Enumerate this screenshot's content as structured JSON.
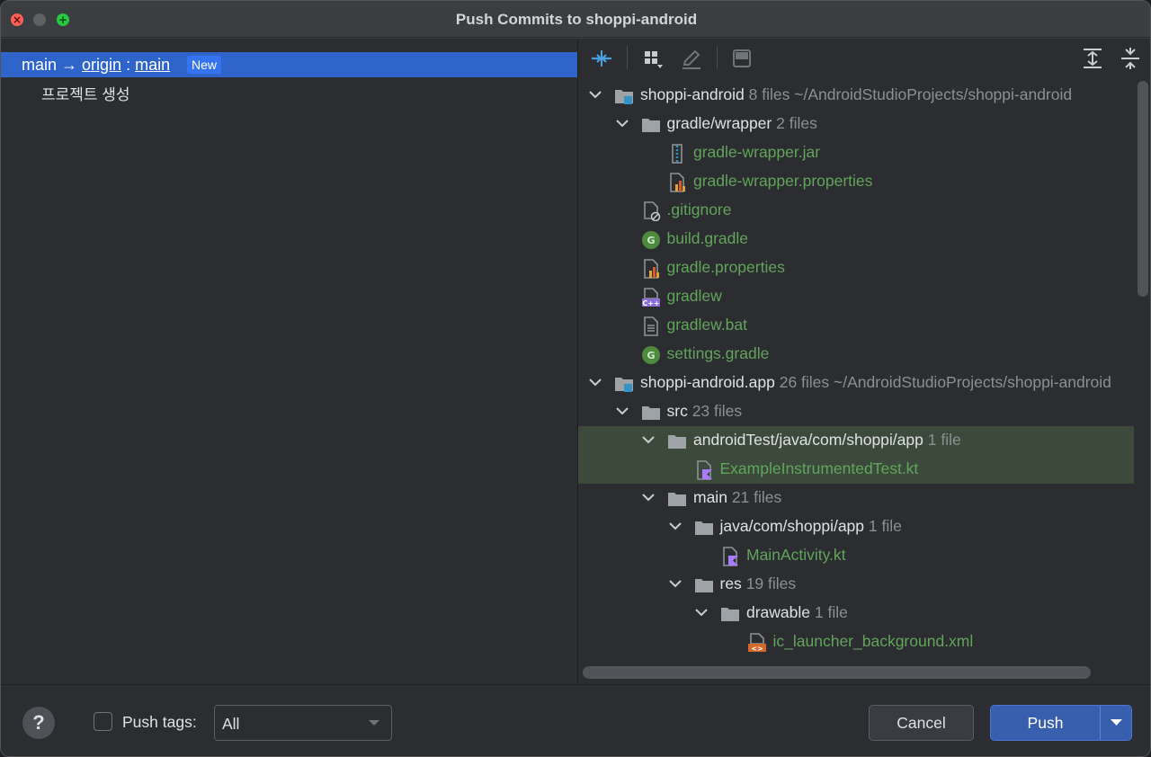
{
  "window": {
    "title": "Push Commits to shoppi-android"
  },
  "left": {
    "branch": {
      "local": "main",
      "arrow": "→",
      "remote": "origin",
      "colon": ":",
      "target": "main",
      "badge": "New"
    },
    "commits": [
      "프로젝트 생성"
    ]
  },
  "toolbar": {
    "icons": [
      "show-diff-icon",
      "group-by-icon",
      "edit-source-icon",
      "preview-icon",
      "expand-all-icon",
      "collapse-all-icon"
    ]
  },
  "tree": [
    {
      "label": "shoppi-android",
      "meta": "8 files ~/AndroidStudioProjects/shoppi-android",
      "icon": "module-icon",
      "color": "white",
      "expanded": true
    },
    {
      "label": "gradle/wrapper",
      "meta": "2 files",
      "icon": "folder-icon",
      "color": "white",
      "expanded": true
    },
    {
      "label": "gradle-wrapper.jar",
      "meta": "",
      "icon": "archive-file-icon",
      "color": "green"
    },
    {
      "label": "gradle-wrapper.properties",
      "meta": "",
      "icon": "properties-file-icon",
      "color": "green"
    },
    {
      "label": ".gitignore",
      "meta": "",
      "icon": "ignore-file-icon",
      "color": "green"
    },
    {
      "label": "build.gradle",
      "meta": "",
      "icon": "gradle-file-icon",
      "color": "green"
    },
    {
      "label": "gradle.properties",
      "meta": "",
      "icon": "properties-file-icon",
      "color": "green"
    },
    {
      "label": "gradlew",
      "meta": "",
      "icon": "cpp-file-icon",
      "color": "green"
    },
    {
      "label": "gradlew.bat",
      "meta": "",
      "icon": "text-file-icon",
      "color": "green"
    },
    {
      "label": "settings.gradle",
      "meta": "",
      "icon": "gradle-file-icon",
      "color": "green"
    },
    {
      "label": "shoppi-android.app",
      "meta": "26 files ~/AndroidStudioProjects/shoppi-android",
      "icon": "module-icon",
      "color": "white",
      "expanded": true
    },
    {
      "label": "src",
      "meta": "23 files",
      "icon": "folder-icon",
      "color": "white",
      "expanded": true
    },
    {
      "label": "androidTest/java/com/shoppi/app",
      "meta": "1 file",
      "icon": "folder-icon",
      "color": "white",
      "expanded": true,
      "selected": true
    },
    {
      "label": "ExampleInstrumentedTest.kt",
      "meta": "",
      "icon": "kotlin-file-icon",
      "color": "green",
      "selected": true
    },
    {
      "label": "main",
      "meta": "21 files",
      "icon": "folder-icon",
      "color": "white",
      "expanded": true
    },
    {
      "label": "java/com/shoppi/app",
      "meta": "1 file",
      "icon": "folder-icon",
      "color": "white",
      "expanded": true
    },
    {
      "label": "MainActivity.kt",
      "meta": "",
      "icon": "kotlin-file-icon",
      "color": "green"
    },
    {
      "label": "res",
      "meta": "19 files",
      "icon": "folder-icon",
      "color": "white",
      "expanded": true
    },
    {
      "label": "drawable",
      "meta": "1 file",
      "icon": "folder-icon",
      "color": "white",
      "expanded": true
    },
    {
      "label": "ic_launcher_background.xml",
      "meta": "",
      "icon": "xml-file-icon",
      "color": "green"
    }
  ],
  "bottom": {
    "help": "?",
    "push_tags_label": "Push tags:",
    "push_tags_checked": false,
    "tags_select": "All",
    "cancel": "Cancel",
    "push": "Push"
  },
  "colors": {
    "accent": "#2f65ca",
    "added_file": "#61a55b",
    "selected_row": "#3c4a3b",
    "push_button": "#375fad"
  }
}
